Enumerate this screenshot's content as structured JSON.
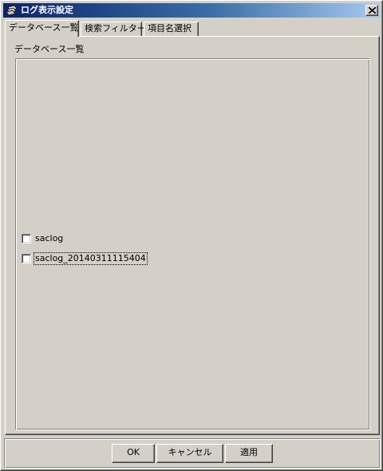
{
  "window": {
    "title": "ログ表示設定",
    "close_label": "×"
  },
  "tabs": [
    {
      "label": "データベース一覧",
      "active": true
    },
    {
      "label": "検索フィルター",
      "active": false
    },
    {
      "label": "項目名選択",
      "active": false
    }
  ],
  "database_list": {
    "group_label": "データベース一覧",
    "items": [
      {
        "label": "saclog",
        "checked": false,
        "focused": false
      },
      {
        "label": "saclog_20140311115404",
        "checked": false,
        "focused": true
      }
    ]
  },
  "buttons": {
    "ok_label": "OK",
    "cancel_label": "キャンセル",
    "apply_label": "適用"
  },
  "colors": {
    "titlebar_start": "#0a246a",
    "titlebar_end": "#a6caf0",
    "face": "#d4d0c8"
  }
}
